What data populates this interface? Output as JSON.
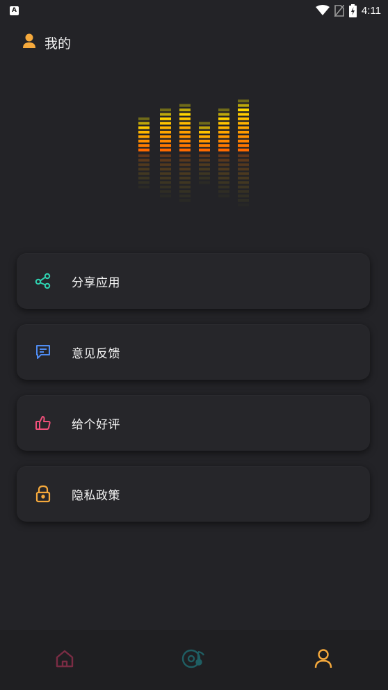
{
  "status_bar": {
    "app_badge": "A",
    "time": "4:11",
    "icons": [
      "wifi-icon",
      "no-sim-icon",
      "battery-charging-icon"
    ]
  },
  "header": {
    "icon": "user-icon",
    "title": "我的"
  },
  "menu": [
    {
      "label": "分享应用",
      "icon": "share-icon",
      "color": "#2fd4b2"
    },
    {
      "label": "意见反馈",
      "icon": "feedback-icon",
      "color": "#4f8cf2"
    },
    {
      "label": "给个好评",
      "icon": "thumbs-up-icon",
      "color": "#f0507a"
    },
    {
      "label": "隐私政策",
      "icon": "lock-icon",
      "color": "#f5a93c"
    }
  ],
  "bottom_nav": {
    "items": [
      {
        "name": "home",
        "icon": "home-icon",
        "color": "#7a2c44",
        "active": false
      },
      {
        "name": "music",
        "icon": "music-disc-icon",
        "color": "#1f5e63",
        "active": false
      },
      {
        "name": "profile",
        "icon": "user-icon",
        "color": "#f5a93c",
        "active": true
      }
    ]
  },
  "colors": {
    "background": "#232327",
    "card": "#26262a",
    "accent": "#f5a93c",
    "equalizer_hot": "#ff6a00",
    "equalizer_cool": "#f5f000"
  },
  "equalizer": {
    "bar_levels": [
      8,
      10,
      11,
      7,
      10,
      12
    ]
  }
}
